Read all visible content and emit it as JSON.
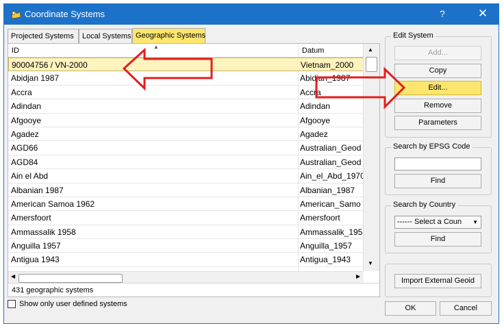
{
  "window": {
    "title": "Coordinate Systems",
    "help": "?",
    "close": "✕"
  },
  "tabs": [
    {
      "label": "Projected Systems"
    },
    {
      "label": "Local Systems"
    },
    {
      "label": "Geographic Systems",
      "active": true
    }
  ],
  "table": {
    "columns": {
      "id": "ID",
      "datum": "Datum"
    },
    "rows": [
      {
        "id": "90004756 / VN-2000",
        "datum": "Vietnam_2000",
        "selected": true
      },
      {
        "id": "Abidjan 1987",
        "datum": "Abidjan_1987"
      },
      {
        "id": "Accra",
        "datum": "Accra"
      },
      {
        "id": "Adindan",
        "datum": "Adindan"
      },
      {
        "id": "Afgooye",
        "datum": "Afgooye"
      },
      {
        "id": "Agadez",
        "datum": "Agadez"
      },
      {
        "id": "AGD66",
        "datum": "Australian_Geod"
      },
      {
        "id": "AGD84",
        "datum": "Australian_Geod"
      },
      {
        "id": "Ain el Abd",
        "datum": "Ain_el_Abd_1970"
      },
      {
        "id": "Albanian 1987",
        "datum": "Albanian_1987"
      },
      {
        "id": "American Samoa 1962",
        "datum": "American_Samo"
      },
      {
        "id": "Amersfoort",
        "datum": "Amersfoort"
      },
      {
        "id": "Ammassalik 1958",
        "datum": "Ammassalik_195"
      },
      {
        "id": "Anguilla 1957",
        "datum": "Anguilla_1957"
      },
      {
        "id": "Antigua 1943",
        "datum": "Antigua_1943"
      }
    ],
    "status": "431 geographic systems"
  },
  "footer": {
    "checkbox_label": "Show only user defined systems"
  },
  "edit_system": {
    "title": "Edit System",
    "add": "Add...",
    "copy": "Copy",
    "edit": "Edit...",
    "remove": "Remove",
    "parameters": "Parameters"
  },
  "search_epsg": {
    "title": "Search by EPSG Code",
    "value": "",
    "find": "Find"
  },
  "search_country": {
    "title": "Search by Country",
    "selected": "------ Select a Coun",
    "find": "Find"
  },
  "import_geoid": "Import External Geoid",
  "dialog": {
    "ok": "OK",
    "cancel": "Cancel"
  },
  "colors": {
    "titlebar": "#1c72c9",
    "highlight": "#fde66d",
    "annotation_arrow": "#e31e1e"
  }
}
